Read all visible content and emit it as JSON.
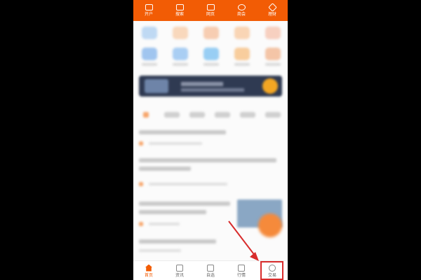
{
  "top_nav": {
    "items": [
      {
        "label": "开户",
        "icon": "chart-screen-icon"
      },
      {
        "label": "搜索",
        "icon": "copy-icon"
      },
      {
        "label": "网页",
        "icon": "document-icon"
      },
      {
        "label": "商会",
        "icon": "coin-icon"
      },
      {
        "label": "理财",
        "icon": "diamond-icon"
      }
    ]
  },
  "bottom_nav": {
    "tabs": [
      {
        "label": "首页",
        "icon": "home-icon",
        "active": true
      },
      {
        "label": "资讯",
        "icon": "news-icon",
        "active": false
      },
      {
        "label": "自选",
        "icon": "checkbox-icon",
        "active": false
      },
      {
        "label": "行情",
        "icon": "trend-chart-icon",
        "active": false
      },
      {
        "label": "交易",
        "icon": "trade-icon",
        "active": false
      }
    ]
  },
  "colors": {
    "brand_orange": "#f25c05",
    "annotation_red": "#d82c2c",
    "banner_dark": "#2f3a52"
  }
}
